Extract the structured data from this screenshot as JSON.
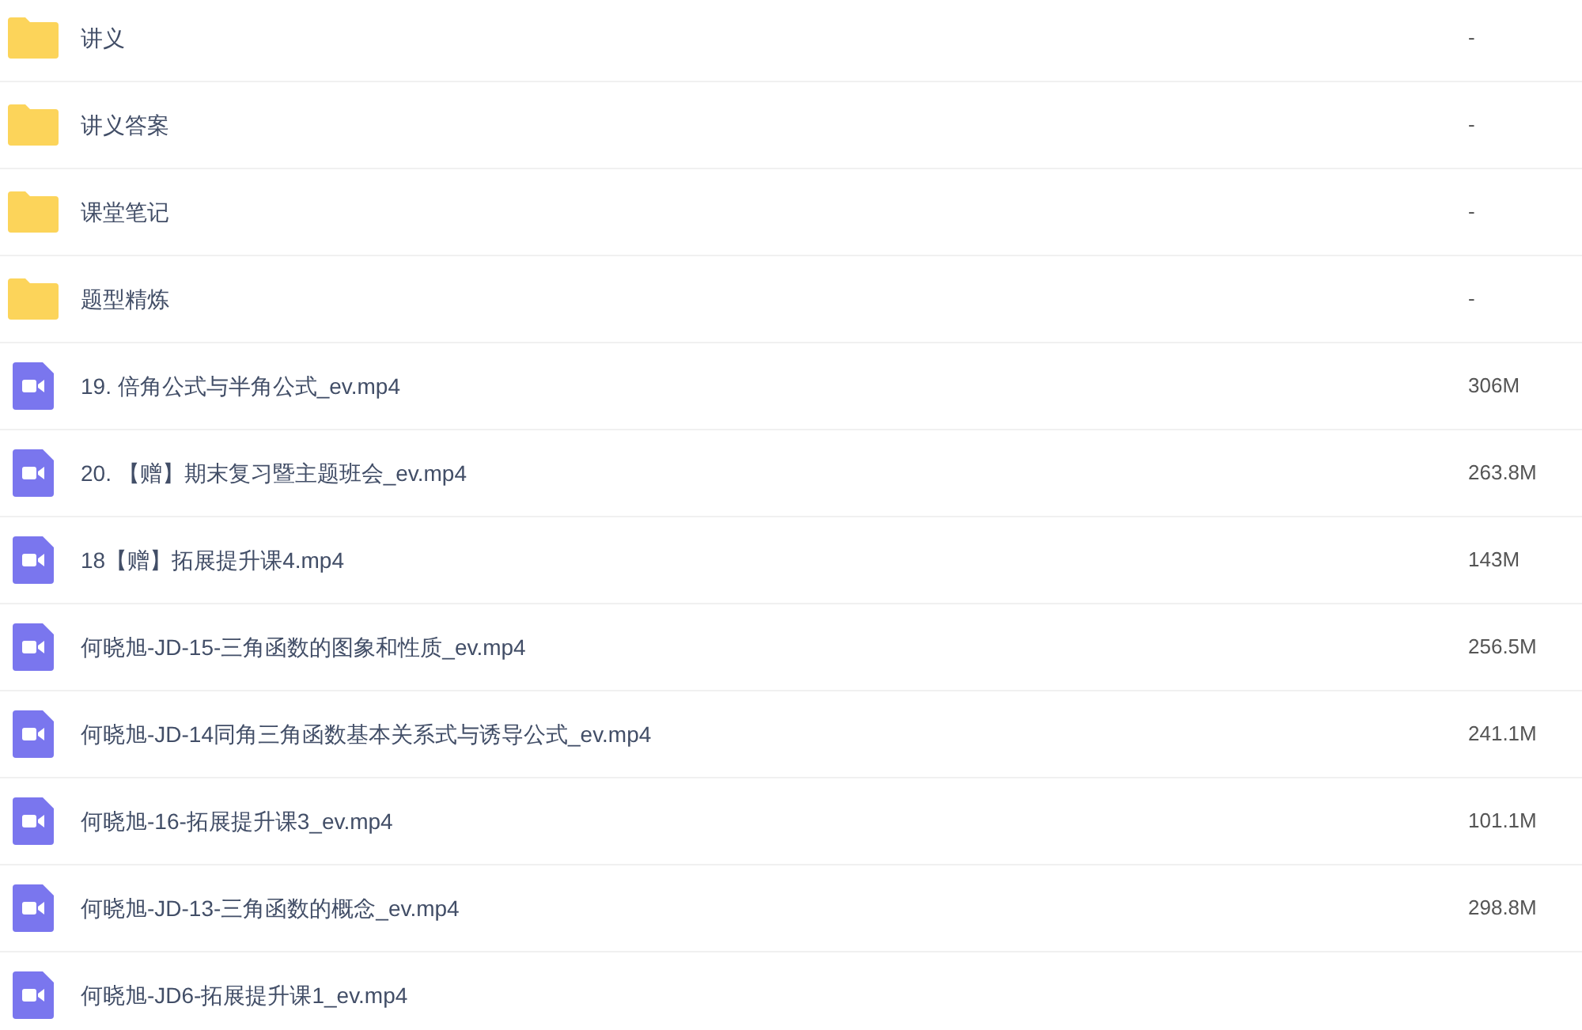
{
  "files": [
    {
      "kind": "folder",
      "name": "讲义",
      "size": "-"
    },
    {
      "kind": "folder",
      "name": "讲义答案",
      "size": "-"
    },
    {
      "kind": "folder",
      "name": "课堂笔记",
      "size": "-"
    },
    {
      "kind": "folder",
      "name": "题型精炼",
      "size": "-"
    },
    {
      "kind": "video",
      "name": "19. 倍角公式与半角公式_ev.mp4",
      "size": "306M"
    },
    {
      "kind": "video",
      "name": "20. 【赠】期末复习暨主题班会_ev.mp4",
      "size": "263.8M"
    },
    {
      "kind": "video",
      "name": "18【赠】拓展提升课4.mp4",
      "size": "143M"
    },
    {
      "kind": "video",
      "name": "何晓旭-JD-15-三角函数的图象和性质_ev.mp4",
      "size": "256.5M"
    },
    {
      "kind": "video",
      "name": "何晓旭-JD-14同角三角函数基本关系式与诱导公式_ev.mp4",
      "size": "241.1M"
    },
    {
      "kind": "video",
      "name": "何晓旭-16-拓展提升课3_ev.mp4",
      "size": "101.1M"
    },
    {
      "kind": "video",
      "name": "何晓旭-JD-13-三角函数的概念_ev.mp4",
      "size": "298.8M"
    },
    {
      "kind": "video",
      "name": "何晓旭-JD6-拓展提升课1_ev.mp4"
    }
  ]
}
